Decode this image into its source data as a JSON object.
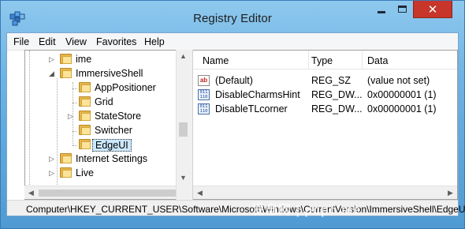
{
  "window": {
    "title": "Registry Editor",
    "close_glyph": "✕"
  },
  "menu": [
    "File",
    "Edit",
    "View",
    "Favorites",
    "Help"
  ],
  "tree": {
    "items": [
      {
        "label": "ime",
        "expander": "▷"
      },
      {
        "label": "ImmersiveShell",
        "expander": "◢"
      },
      {
        "label": "AppPositioner",
        "expander": ""
      },
      {
        "label": "Grid",
        "expander": ""
      },
      {
        "label": "StateStore",
        "expander": "▷"
      },
      {
        "label": "Switcher",
        "expander": ""
      },
      {
        "label": "EdgeUI",
        "expander": "",
        "selected": true
      },
      {
        "label": "Internet Settings",
        "expander": "▷"
      },
      {
        "label": "Live",
        "expander": "▷"
      }
    ]
  },
  "list": {
    "columns": [
      "Name",
      "Type",
      "Data"
    ],
    "rows": [
      {
        "icon": "string-value-icon",
        "name": "(Default)",
        "type": "REG_SZ",
        "data": "(value not set)"
      },
      {
        "icon": "binary-value-icon",
        "name": "DisableCharmsHint",
        "type": "REG_DW...",
        "data": "0x00000001 (1)"
      },
      {
        "icon": "binary-value-icon",
        "name": "DisableTLcorner",
        "type": "REG_DW...",
        "data": "0x00000001 (1)"
      }
    ]
  },
  "status": {
    "path": "Computer\\HKEY_CURRENT_USER\\Software\\Microsoft\\Windows\\CurrentVersion\\ImmersiveShell\\EdgeUI"
  },
  "watermark": "发电网 | pcpc.me",
  "icons": {
    "up_arrow": "▲",
    "down_arrow": "▼",
    "left_arrow": "◀",
    "right_arrow": "▶"
  },
  "colors": {
    "accent_frame": "#6db3e3",
    "close_button": "#c7352b",
    "folder": "#e7b54a"
  }
}
